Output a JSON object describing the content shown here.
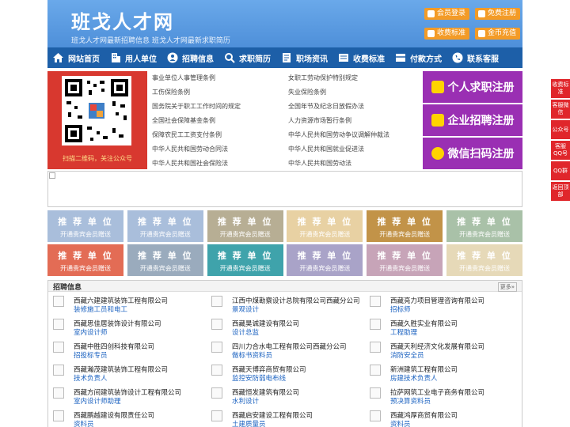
{
  "header": {
    "logo": "班戈人才网",
    "slogan": "班戈人才网最新招聘信息   班戈人才网最新求职简历",
    "buttons": [
      "会员登录",
      "免费注册",
      "收费标准",
      "金币充值"
    ]
  },
  "nav": [
    "网站首页",
    "用人单位",
    "招聘信息",
    "求职简历",
    "职场资讯",
    "收费标准",
    "付款方式",
    "联系客服"
  ],
  "qr": {
    "caption": "扫描二维码，关注公众号"
  },
  "links": [
    [
      "事业单位人事管理条例",
      "女职工劳动保护特别规定"
    ],
    [
      "工伤保险条例",
      "失业保险条例"
    ],
    [
      "国务院关于职工工作时间的规定",
      "全国年节及纪念日放假办法"
    ],
    [
      "全国社会保障基金条例",
      "人力资源市场暂行条例"
    ],
    [
      "保障农民工工资支付条例",
      "中华人民共和国劳动争议调解仲裁法"
    ],
    [
      "中华人民共和国劳动合同法",
      "中华人民共和国就业促进法"
    ],
    [
      "中华人民共和国社会保险法",
      "中华人民共和国劳动法"
    ]
  ],
  "register": [
    "个人求职注册",
    "企业招聘注册",
    "微信扫码注册"
  ],
  "tiles": {
    "title": "推 荐 单 位",
    "sub": "开通贵宾会员赠送",
    "colors": [
      "#a9bedb",
      "#a9bedb",
      "#b7ae94",
      "#e8d1a3",
      "#c29348",
      "#a9c1a8",
      "#e36c55",
      "#9aabbd",
      "#3fa3ab",
      "#a9a3c8",
      "#c7a4b8",
      "#e6d9b8"
    ]
  },
  "jobs": {
    "title": "招聘信息",
    "more": "更多»",
    "items": [
      {
        "co": "西藏六建建筑装饰工程有限公司",
        "pos": "装修施工员和电工"
      },
      {
        "co": "江西中煤勘察设计总院有限公司西藏分公司",
        "pos": "景观设计"
      },
      {
        "co": "西藏亮力项目管理咨询有限公司",
        "pos": "招标师"
      },
      {
        "co": "西藏思佳居装饰设计有限公司",
        "pos": "室内设计师"
      },
      {
        "co": "西藏昊诚建设有限公司",
        "pos": "设计总监"
      },
      {
        "co": "西藏久胜实业有限公司",
        "pos": "工程助理"
      },
      {
        "co": "西藏中胜四创科技有限公司",
        "pos": "招投标专员"
      },
      {
        "co": "四川力合水电工程有限公司西藏分公司",
        "pos": "做标书资料员"
      },
      {
        "co": "西藏天利经济文化发展有限公司",
        "pos": "消防安全员"
      },
      {
        "co": "西藏瀚茂建筑装饰工程有限公司",
        "pos": "技术负责人"
      },
      {
        "co": "西藏天博弈商贸有限公司",
        "pos": "监控安防弱电布线"
      },
      {
        "co": "新洲建筑工程有限公司",
        "pos": "房建技术负责人"
      },
      {
        "co": "西藏方间建筑装饰设计工程有限公司",
        "pos": "室内设计师助理"
      },
      {
        "co": "西藏恒发建筑有限公司",
        "pos": "水利设计"
      },
      {
        "co": "拉萨网筑工业电子商务有限公司",
        "pos": "预决算资料员"
      },
      {
        "co": "西藏鹏越建设有限责任公司",
        "pos": "资料员"
      },
      {
        "co": "西藏启安建设工程有限公司",
        "pos": "土建质量员"
      },
      {
        "co": "西藏鸿厚商贸有限公司",
        "pos": "资料员"
      }
    ]
  },
  "side": [
    "收费标准",
    "客服微信",
    "公众号",
    "客服QQ号",
    "QQ群",
    "返回顶部"
  ]
}
